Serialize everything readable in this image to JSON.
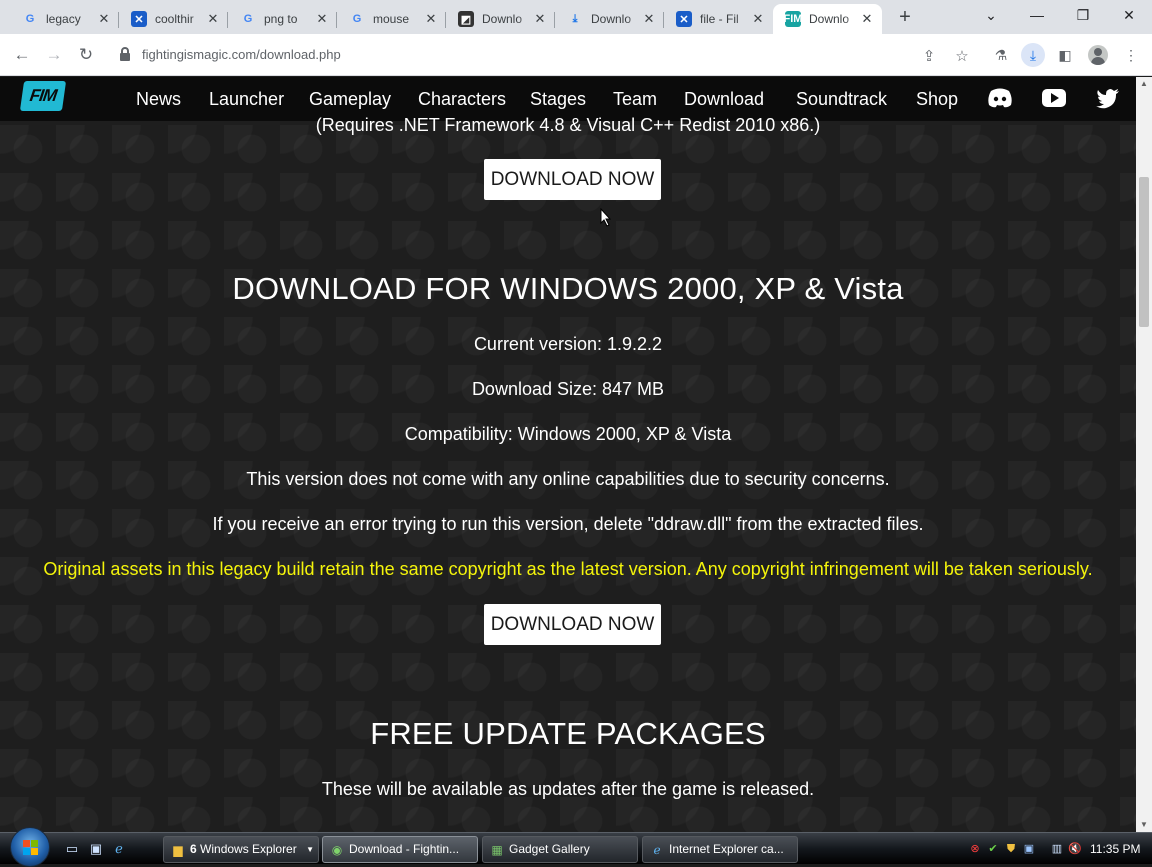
{
  "browser": {
    "tabs": [
      {
        "title": "legacy",
        "favicon": "google-icon"
      },
      {
        "title": "coolthir",
        "favicon": "site-icon"
      },
      {
        "title": "png to",
        "favicon": "google-icon"
      },
      {
        "title": "mouse",
        "favicon": "google-icon"
      },
      {
        "title": "Downlo",
        "favicon": "site-icon"
      },
      {
        "title": "Downlo",
        "favicon": "download-icon"
      },
      {
        "title": "file - Fil",
        "favicon": "site-icon"
      },
      {
        "title": "Downlo",
        "favicon": "fim-icon",
        "active": true
      }
    ],
    "url": "fightingismagic.com/download.php",
    "accent": "#1a73e8"
  },
  "site": {
    "logo_text": "FIM",
    "nav": [
      "News",
      "Launcher",
      "Gameplay",
      "Characters",
      "Stages",
      "Team",
      "Download",
      "Soundtrack",
      "Shop"
    ],
    "logo_color": "#21b9d3"
  },
  "content": {
    "requires_note": "(Requires .NET Framework 4.8 & Visual C++ Redist 2010 x86.)",
    "download_button_1": "DOWNLOAD NOW",
    "legacy_heading": "DOWNLOAD FOR WINDOWS 2000, XP & Vista",
    "current_version": "Current version: 1.9.2.2",
    "download_size": "Download Size: 847 MB",
    "compatibility": "Compatibility: Windows 2000, XP & Vista",
    "online_note": "This version does not come with any online capabilities due to security concerns.",
    "ddraw_note": "If you receive an error trying to run this version, delete \"ddraw.dll\" from the extracted files.",
    "copyright_note": "Original assets in this legacy build retain the same copyright as the latest version. Any copyright infringement will be taken seriously.",
    "download_button_2": "DOWNLOAD NOW",
    "updates_heading": "FREE UPDATE PACKAGES",
    "updates_note": "These will be available as updates after the game is released.",
    "warning_color": "#f4f40b"
  },
  "taskbar": {
    "tasks": [
      {
        "count": "6",
        "label": "Windows Explorer"
      },
      {
        "label": "Download - Fightin..."
      },
      {
        "label": "Gadget Gallery"
      },
      {
        "label": "Internet Explorer ca..."
      }
    ],
    "clock": "11:35 PM"
  }
}
